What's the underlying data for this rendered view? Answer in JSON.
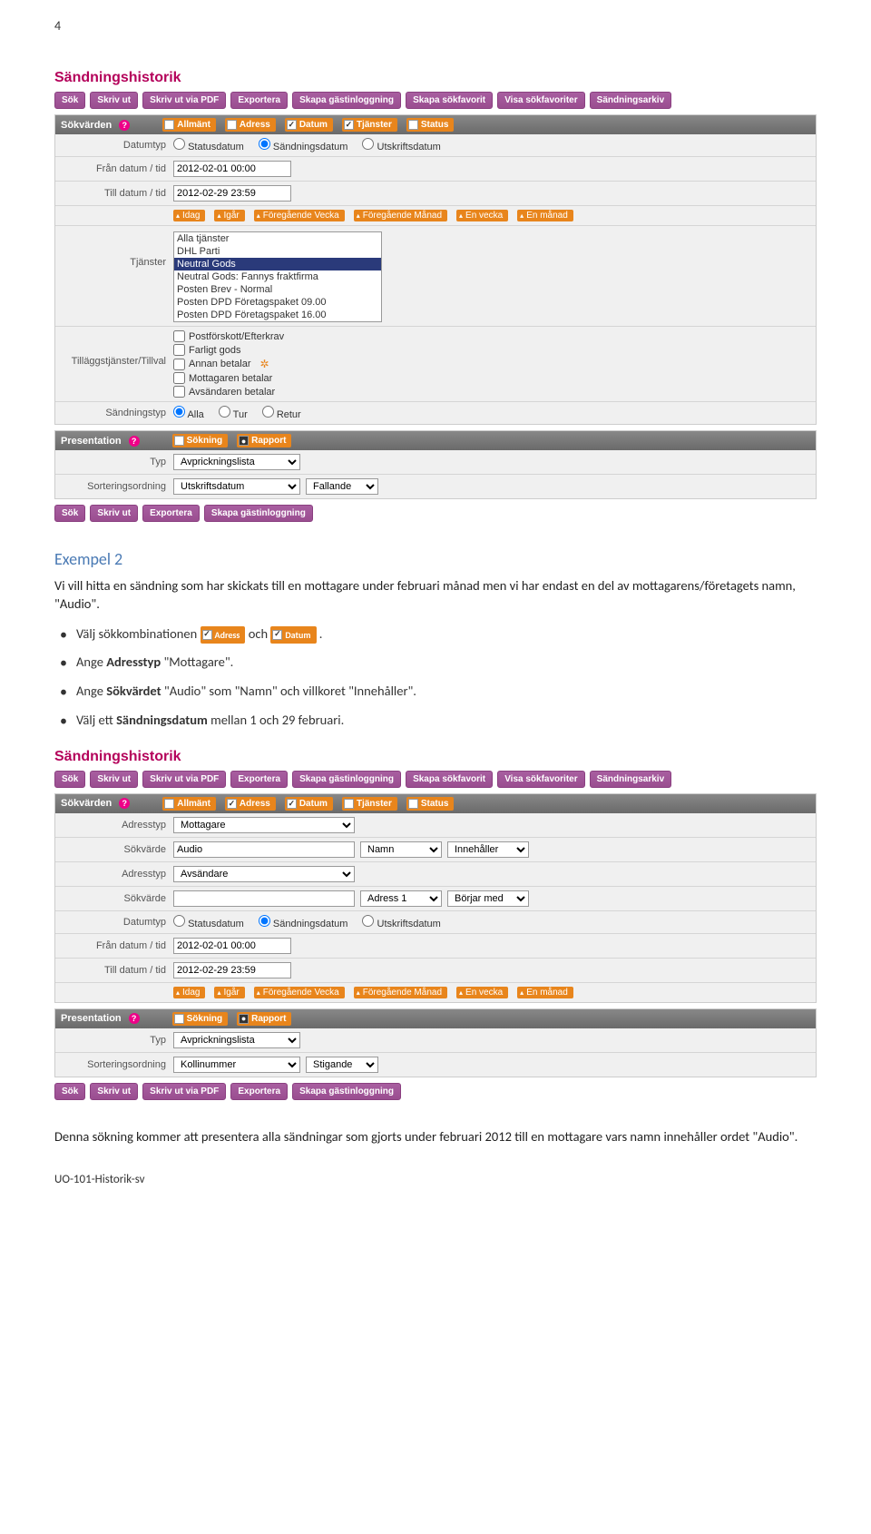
{
  "pageNumber": "4",
  "app": {
    "title": "Sändningshistorik",
    "topButtons": [
      "Sök",
      "Skriv ut",
      "Skriv ut via PDF",
      "Exportera",
      "Skapa gästinloggning",
      "Skapa sökfavorit",
      "Visa sökfavoriter",
      "Sändningsarkiv"
    ],
    "bottomButtons1": [
      "Sök",
      "Skriv ut",
      "Exportera",
      "Skapa gästinloggning"
    ],
    "bottomButtons2": [
      "Sök",
      "Skriv ut",
      "Skriv ut via PDF",
      "Exportera",
      "Skapa gästinloggning"
    ]
  },
  "sokvarden": {
    "label": "Sökvärden",
    "tabs": [
      "Allmänt",
      "Adress",
      "Datum",
      "Tjänster",
      "Status"
    ],
    "tabsChecked1": [
      false,
      false,
      true,
      true,
      false
    ],
    "tabsChecked2": [
      false,
      true,
      true,
      false,
      false
    ],
    "datumtypLabel": "Datumtyp",
    "datumOptions": [
      "Statusdatum",
      "Sändningsdatum",
      "Utskriftsdatum"
    ],
    "franLabel": "Från datum / tid",
    "franValue": "2012-02-01 00:00",
    "tillLabel": "Till datum / tid",
    "tillValue": "2012-02-29 23:59",
    "quickDates": [
      "Idag",
      "Igår",
      "Föregående Vecka",
      "Föregående Månad",
      "En vecka",
      "En månad"
    ],
    "tjansterLabel": "Tjänster",
    "tjansterOptions": [
      "Alla tjänster",
      "DHL Parti",
      "Neutral Gods",
      "Neutral Gods: Fannys fraktfirma",
      "Posten Brev - Normal",
      "Posten DPD Företagspaket 09.00",
      "Posten DPD Företagspaket 16.00"
    ],
    "tillaggLabel": "Tilläggstjänster/Tillval",
    "tillaggOptions": [
      "Postförskott/Efterkrav",
      "Farligt gods",
      "Annan betalar",
      "Mottagaren betalar",
      "Avsändaren betalar"
    ],
    "sandningstypLabel": "Sändningstyp",
    "sandningstypOptions": [
      "Alla",
      "Tur",
      "Retur"
    ],
    "adresstypLabel": "Adresstyp",
    "adresstyp1": "Mottagare",
    "adresstyp2": "Avsändare",
    "sokvardeLabel": "Sökvärde",
    "sokvarde1": "Audio",
    "sokvarde2": "",
    "fieldSelect1": "Namn",
    "fieldSelect2": "Adress 1",
    "matchSelect1": "Innehåller",
    "matchSelect2": "Börjar med"
  },
  "presentation": {
    "label": "Presentation",
    "tabs": [
      "Sökning",
      "Rapport"
    ],
    "typLabel": "Typ",
    "typValue": "Avprickningslista",
    "sortLabel": "Sorteringsordning",
    "sortValue1": "Utskriftsdatum",
    "sortValue1b": "Fallande",
    "sortValue2": "Kollinummer",
    "sortValue2b": "Stigande"
  },
  "example": {
    "heading": "Exempel 2",
    "intro": "Vi vill hitta en sändning som har skickats till en mottagare under februari månad men vi har endast en del av mottagarens/företagets namn, \"Audio\".",
    "bullet1a": "Välj sökkombinationen ",
    "bullet1b": " och ",
    "bullet1c": ".",
    "badge1": "Adress",
    "badge2": "Datum",
    "bullet2": "Ange Adresstyp \"Mottagare\".",
    "bullet3": "Ange Sökvärdet \"Audio\" som \"Namn\" och villkoret \"Innehåller\".",
    "bullet4": "Välj ett Sändningsdatum mellan 1 och 29 februari.",
    "closing": "Denna sökning kommer att presentera alla sändningar som gjorts under februari 2012 till en mottagare vars namn innehåller ordet \"Audio\"."
  },
  "footer": "UO-101-Historik-sv"
}
